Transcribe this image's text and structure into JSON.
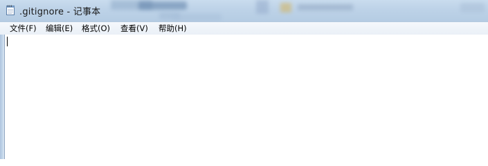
{
  "window": {
    "title": ".gitignore - 记事本",
    "icon": "notepad-icon"
  },
  "menu": {
    "items": [
      {
        "label": "文件(F)"
      },
      {
        "label": "编辑(E)"
      },
      {
        "label": "格式(O)"
      },
      {
        "label": "查看(V)"
      },
      {
        "label": "帮助(H)"
      }
    ]
  },
  "editor": {
    "content": ""
  },
  "colors": {
    "titlebar": "#bed3e8",
    "menubar": "#eaf0f7",
    "editor_bg": "#ffffff"
  }
}
